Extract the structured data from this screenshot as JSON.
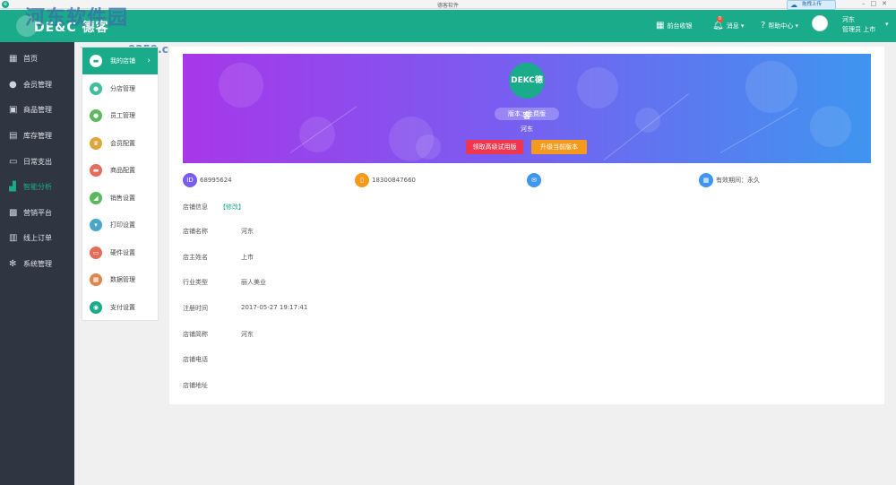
{
  "window": {
    "title": "德客软件",
    "upload_label": "拖拽上传"
  },
  "header": {
    "logo_text": "DE&C 德客",
    "watermark": "河东软件园",
    "watermark_url": "www.pc0359.cn",
    "cashier": "前台收银",
    "message": "消息",
    "message_count": "0",
    "help": "帮助中心",
    "user_name": "河东",
    "user_role": "管理员",
    "user_title": "上市"
  },
  "sidebar": {
    "items": [
      {
        "label": "首页",
        "icon": "home-icon"
      },
      {
        "label": "会员管理",
        "icon": "user-icon"
      },
      {
        "label": "商品管理",
        "icon": "box-icon"
      },
      {
        "label": "库存管理",
        "icon": "inventory-icon"
      },
      {
        "label": "日常支出",
        "icon": "card-icon"
      },
      {
        "label": "智能分析",
        "icon": "chart-icon"
      },
      {
        "label": "营销平台",
        "icon": "gift-icon"
      },
      {
        "label": "线上订单",
        "icon": "clipboard-icon"
      },
      {
        "label": "系统管理",
        "icon": "gear-icon"
      }
    ],
    "active_index": 5
  },
  "submenu": {
    "items": [
      {
        "label": "我的店铺",
        "color": "#1aab8a"
      },
      {
        "label": "分店管理",
        "color": "#3fbf9b"
      },
      {
        "label": "员工管理",
        "color": "#5bb85d"
      },
      {
        "label": "会员配置",
        "color": "#e0a53a"
      },
      {
        "label": "商品配置",
        "color": "#e66c5a"
      },
      {
        "label": "销售设置",
        "color": "#5bb85d"
      },
      {
        "label": "打印设置",
        "color": "#4aa6c9"
      },
      {
        "label": "硬件设置",
        "color": "#e66c5a"
      },
      {
        "label": "数据管理",
        "color": "#e0854a"
      },
      {
        "label": "支付设置",
        "color": "#1aab8a"
      }
    ],
    "active_index": 0
  },
  "banner": {
    "logo_text": "DEKC德客",
    "version": "版本：免费版",
    "owner": "河东",
    "trial_button": "领取高级试用版",
    "upgrade_button": "升级当前版本"
  },
  "info_chips": [
    {
      "icon": "id-icon",
      "text": "68995624",
      "color": "#7a5cf0"
    },
    {
      "icon": "phone-icon",
      "text": "18300847660",
      "color": "#f59a1d"
    },
    {
      "icon": "mail-icon",
      "text": "",
      "color": "#3f95f0"
    },
    {
      "icon": "calendar-icon",
      "text": "有效期间：永久",
      "color": "#3f95f0"
    }
  ],
  "store_info": {
    "title": "店铺信息",
    "edit_label": "【修改】",
    "fields": [
      {
        "label": "店铺名称",
        "value": "河东"
      },
      {
        "label": "店主姓名",
        "value": "上市"
      },
      {
        "label": "行业类型",
        "value": "丽人美业"
      },
      {
        "label": "注册时间",
        "value": "2017-05-27 19:17:41"
      },
      {
        "label": "店铺简称",
        "value": "河东"
      },
      {
        "label": "店铺电话",
        "value": ""
      },
      {
        "label": "店铺地址",
        "value": ""
      }
    ]
  }
}
